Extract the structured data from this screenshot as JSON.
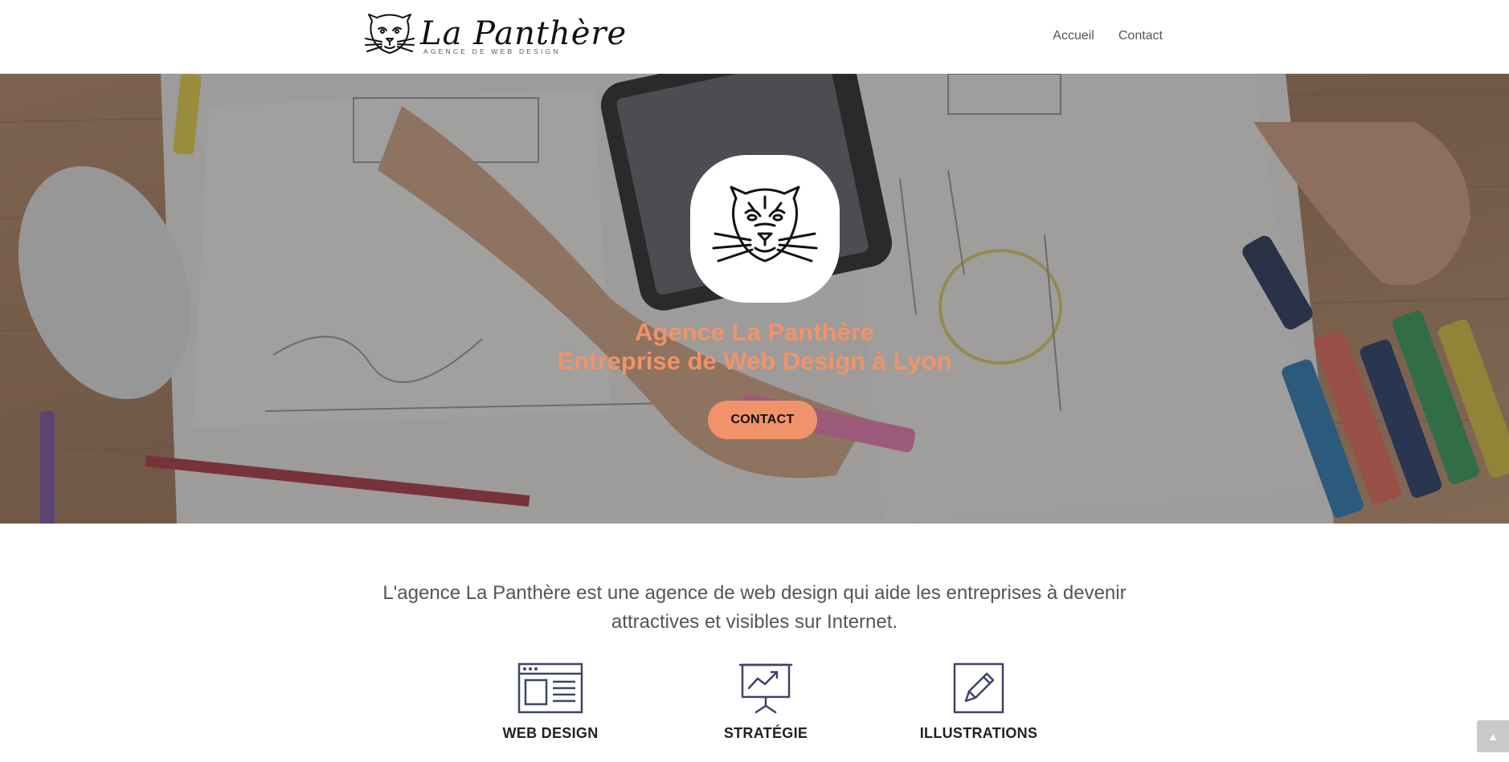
{
  "header": {
    "logo": {
      "name": "La Panthère",
      "tagline": "AGENCE DE WEB DESIGN",
      "icon": "panther-head-icon"
    },
    "nav": [
      {
        "label": "Accueil"
      },
      {
        "label": "Contact"
      }
    ]
  },
  "hero": {
    "emblem_icon": "panther-head-icon",
    "title_line1": "Agence La Panthère",
    "title_line2": "Entreprise de Web Design à Lyon",
    "cta_label": "CONTACT",
    "accent_color": "#f0936a"
  },
  "intro": {
    "text": "L'agence La Panthère est une agence de web design qui aide les entreprises à devenir attractives et visibles sur Internet."
  },
  "services": [
    {
      "label": "WEB DESIGN",
      "icon": "browser-window-icon"
    },
    {
      "label": "STRATÉGIE",
      "icon": "presentation-chart-icon"
    },
    {
      "label": "ILLUSTRATIONS",
      "icon": "pencil-square-icon"
    }
  ],
  "scroll_top": {
    "icon": "chevron-up-icon",
    "symbol": "▲"
  },
  "colors": {
    "accent": "#f0936a",
    "icon_stroke": "#3f4466",
    "text": "#555555"
  }
}
